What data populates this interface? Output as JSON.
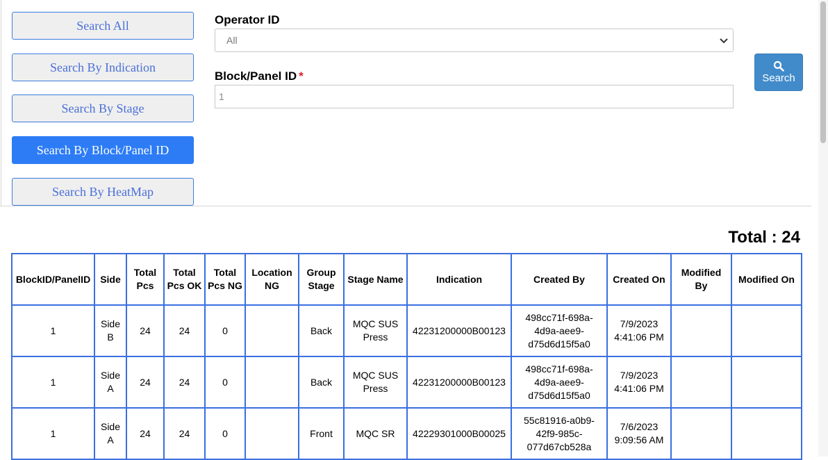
{
  "nav": {
    "buttons": [
      {
        "label": "Search All"
      },
      {
        "label": "Search By Indication"
      },
      {
        "label": "Search By Stage"
      },
      {
        "label": "Search By Block/Panel ID"
      },
      {
        "label": "Search By HeatMap"
      }
    ],
    "active_index": 3
  },
  "form": {
    "operator_label": "Operator ID",
    "operator_value": "All",
    "block_label": "Block/Panel ID",
    "required_mark": "*",
    "block_value": "1",
    "search_label": "Search"
  },
  "summary": {
    "total_text": "Total : 24"
  },
  "table": {
    "headers": [
      "BlockID/PanelID",
      "Side",
      "Total Pcs",
      "Total Pcs OK",
      "Total Pcs NG",
      "Location NG",
      "Group Stage",
      "Stage Name",
      "Indication",
      "Created By",
      "Created On",
      "Modified By",
      "Modified On"
    ],
    "rows": [
      [
        "1",
        "Side B",
        "24",
        "24",
        "0",
        "",
        "Back",
        "MQC SUS Press",
        "42231200000B00123",
        "498cc71f-698a-4d9a-aee9-d75d6d15f5a0",
        "7/9/2023 4:41:06 PM",
        "",
        ""
      ],
      [
        "1",
        "Side A",
        "24",
        "24",
        "0",
        "",
        "Back",
        "MQC SUS Press",
        "42231200000B00123",
        "498cc71f-698a-4d9a-aee9-d75d6d15f5a0",
        "7/9/2023 4:41:06 PM",
        "",
        ""
      ],
      [
        "1",
        "Side A",
        "24",
        "24",
        "0",
        "",
        "Front",
        "MQC SR",
        "42229301000B00025",
        "55c81916-a0b9-42f9-985c-077d67cb528a",
        "7/6/2023 9:09:56 AM",
        "",
        ""
      ]
    ]
  },
  "colors": {
    "accent": "#2d7cf6",
    "button_blue": "#428bca",
    "border_blue": "#3a6fe0",
    "required": "#e02020"
  },
  "icons": {
    "search": "search-icon",
    "dropdown": "chevron-down-icon"
  }
}
